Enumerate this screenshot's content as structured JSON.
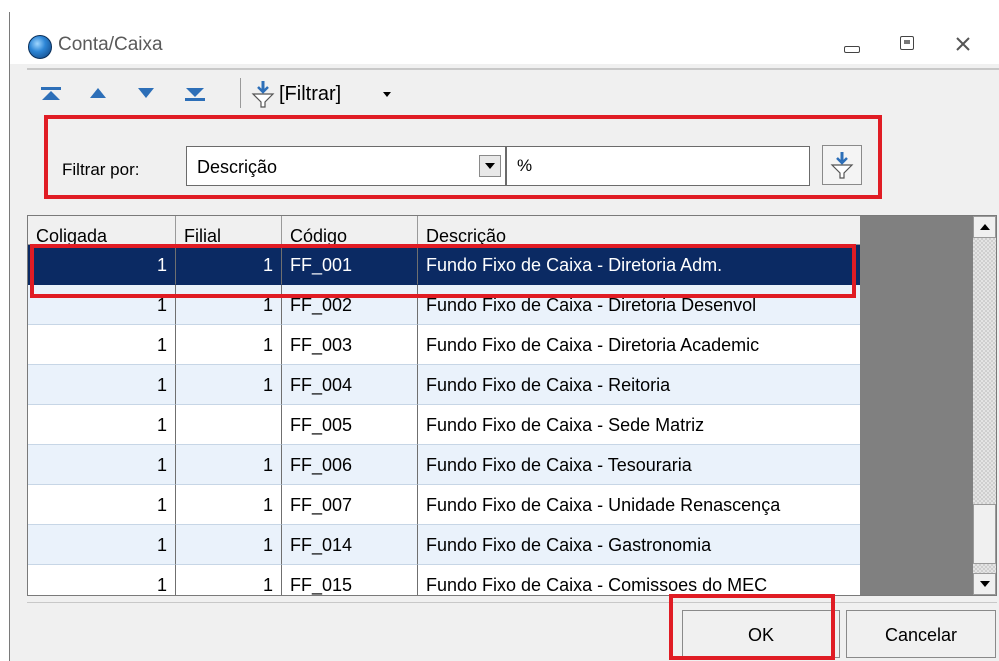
{
  "window": {
    "title": "Conta/Caixa"
  },
  "toolbar": {
    "filter_label": "[Filtrar]"
  },
  "filter": {
    "label": "Filtrar por:",
    "field_value": "Descrição",
    "text_value": "%"
  },
  "grid": {
    "headers": [
      "Coligada",
      "Filial",
      "Código",
      "Descrição"
    ],
    "rows": [
      {
        "coligada": "1",
        "filial": "1",
        "codigo": "FF_001",
        "descricao": "Fundo Fixo de Caixa - Diretoria Adm."
      },
      {
        "coligada": "1",
        "filial": "1",
        "codigo": "FF_002",
        "descricao": "Fundo Fixo de Caixa - Diretoria Desenvol"
      },
      {
        "coligada": "1",
        "filial": "1",
        "codigo": "FF_003",
        "descricao": "Fundo Fixo de Caixa - Diretoria Academic"
      },
      {
        "coligada": "1",
        "filial": "1",
        "codigo": "FF_004",
        "descricao": "Fundo Fixo de Caixa - Reitoria"
      },
      {
        "coligada": "1",
        "filial": "",
        "codigo": "FF_005",
        "descricao": "Fundo Fixo de Caixa - Sede Matriz"
      },
      {
        "coligada": "1",
        "filial": "1",
        "codigo": "FF_006",
        "descricao": "Fundo Fixo de Caixa - Tesouraria"
      },
      {
        "coligada": "1",
        "filial": "1",
        "codigo": "FF_007",
        "descricao": "Fundo Fixo de Caixa - Unidade Renascença"
      },
      {
        "coligada": "1",
        "filial": "1",
        "codigo": "FF_014",
        "descricao": "Fundo Fixo de Caixa - Gastronomia"
      },
      {
        "coligada": "1",
        "filial": "1",
        "codigo": "FF_015",
        "descricao": "Fundo Fixo de Caixa - Comissoes do MEC"
      }
    ]
  },
  "buttons": {
    "ok": "OK",
    "cancel": "Cancelar"
  },
  "colors": {
    "highlight": "#e01c24",
    "selection": "#0b2a63",
    "alt_row": "#eaf2fb"
  },
  "icons": [
    "first-record-icon",
    "previous-record-icon",
    "next-record-icon",
    "last-record-icon",
    "filter-icon",
    "dropdown-arrow-icon",
    "close-icon"
  ]
}
